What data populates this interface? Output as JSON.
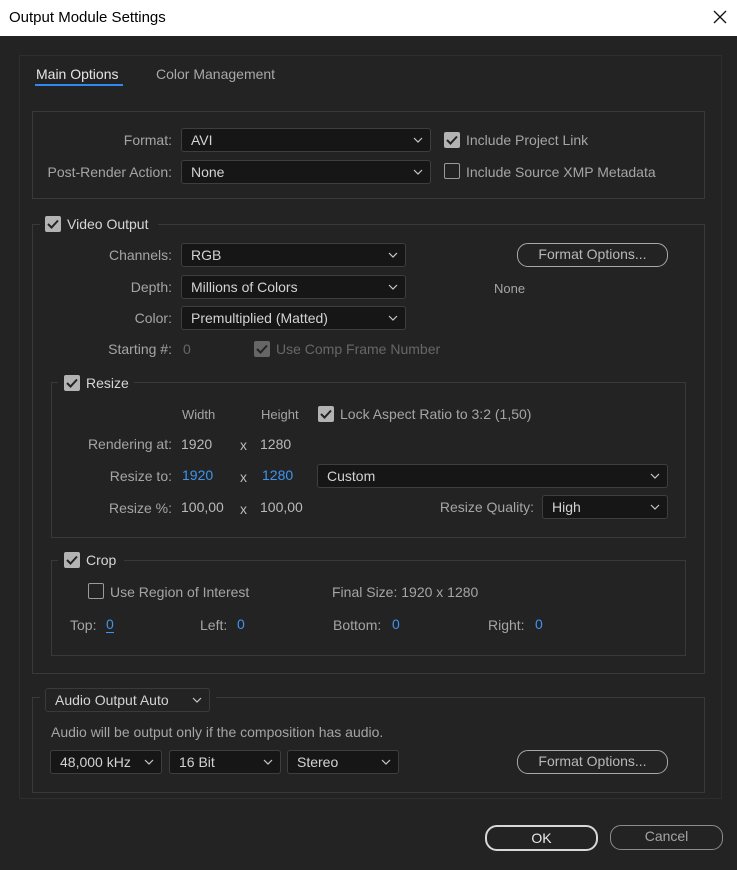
{
  "window": {
    "title": "Output Module Settings"
  },
  "tabs": [
    {
      "label": "Main Options"
    },
    {
      "label": "Color Management"
    }
  ],
  "format": {
    "format_label": "Format:",
    "format_value": "AVI",
    "post_render_label": "Post-Render Action:",
    "post_render_value": "None",
    "include_project_link": "Include Project Link",
    "include_xmp": "Include Source XMP Metadata"
  },
  "video": {
    "section_label": "Video Output",
    "channels_label": "Channels:",
    "channels_value": "RGB",
    "depth_label": "Depth:",
    "depth_value": "Millions of Colors",
    "color_label": "Color:",
    "color_value": "Premultiplied (Matted)",
    "starting_label": "Starting #:",
    "starting_value": "0",
    "use_comp_frame": "Use Comp Frame Number",
    "format_options_label": "Format Options...",
    "codec_summary": "None"
  },
  "resize": {
    "section_label": "Resize",
    "width_header": "Width",
    "height_header": "Height",
    "lock_aspect": "Lock Aspect Ratio to 3:2 (1,50)",
    "rendering_at_label": "Rendering at:",
    "rendering_w": "1920",
    "rendering_h": "1280",
    "resize_to_label": "Resize to:",
    "resize_w": "1920",
    "resize_h": "1280",
    "preset_value": "Custom",
    "resize_pct_label": "Resize %:",
    "pct_w": "100,00",
    "pct_h": "100,00",
    "quality_label": "Resize Quality:",
    "quality_value": "High",
    "times": "x"
  },
  "crop": {
    "section_label": "Crop",
    "use_roi": "Use Region of Interest",
    "final_size": "Final Size: 1920 x 1280",
    "top_label": "Top:",
    "top_value": "0",
    "left_label": "Left:",
    "left_value": "0",
    "bottom_label": "Bottom:",
    "bottom_value": "0",
    "right_label": "Right:",
    "right_value": "0"
  },
  "audio": {
    "mode_value": "Audio Output Auto",
    "note": "Audio will be output only if the composition has audio.",
    "rate_value": "48,000 kHz",
    "bits_value": "16 Bit",
    "channels_value": "Stereo",
    "format_options_label": "Format Options..."
  },
  "footer": {
    "ok_label": "OK",
    "cancel_label": "Cancel"
  }
}
